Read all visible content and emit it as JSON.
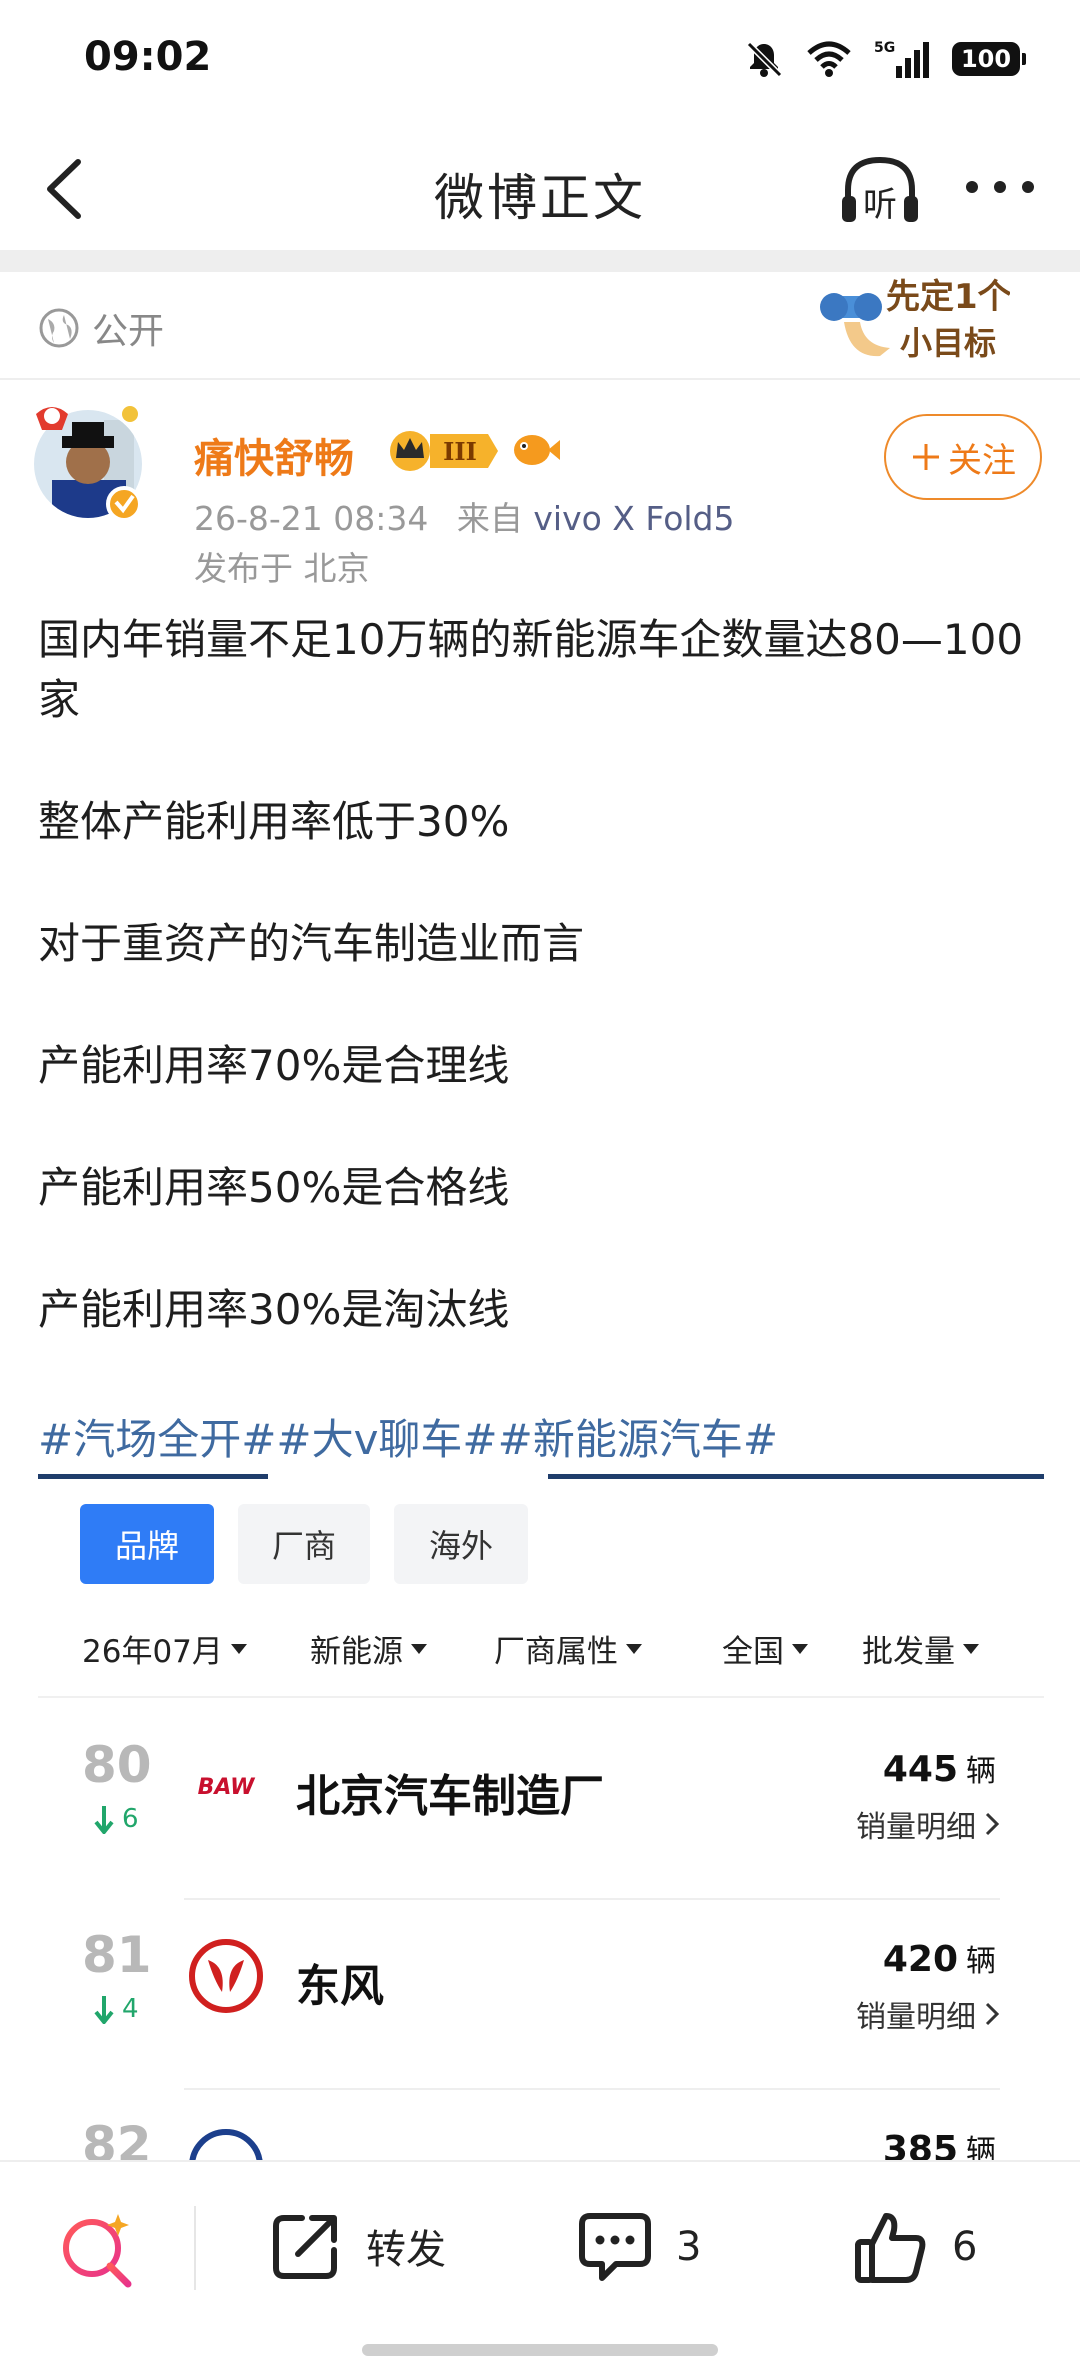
{
  "status_bar": {
    "time": "09:02",
    "network": "5G",
    "battery": "100"
  },
  "nav": {
    "title": "微博正文",
    "listen_label": "听"
  },
  "visibility": {
    "label": "公开"
  },
  "sticker_text": [
    "先定1个",
    "小目标"
  ],
  "author": {
    "name": "痛快舒畅",
    "level_badge": "III",
    "time": "26-8-21 08:34",
    "source_prefix": "来自",
    "device": "vivo X Fold5",
    "location": "发布于 北京",
    "follow_label": "关注"
  },
  "post": {
    "paragraphs": [
      "国内年销量不足10万辆的新能源车企数量达80—100家",
      "整体产能利用率低于30%",
      "对于重资产的汽车制造业而言",
      "产能利用率70%是合理线",
      "产能利用率50%是合格线",
      "产能利用率30%是淘汰线"
    ],
    "hashtags": "#汽场全开##大v聊车##新能源汽车#"
  },
  "card": {
    "tabs": [
      {
        "label": "品牌",
        "active": true
      },
      {
        "label": "厂商",
        "active": false
      },
      {
        "label": "海外",
        "active": false
      }
    ],
    "filters": [
      "26年07月",
      "新能源",
      "厂商属性",
      "全国",
      "批发量"
    ],
    "rows": [
      {
        "rank": "80",
        "delta": "6",
        "logo": "BAW",
        "name": "北京汽车制造厂",
        "qty": "445",
        "unit": "辆",
        "detail": "销量明细"
      },
      {
        "rank": "81",
        "delta": "4",
        "logo": "dongfeng-logo",
        "name": "东风",
        "qty": "420",
        "unit": "辆",
        "detail": "销量明细"
      },
      {
        "rank": "82",
        "delta": "",
        "logo": "circle-logo",
        "name": "",
        "qty": "385",
        "unit": "辆",
        "detail": ""
      }
    ]
  },
  "bottom_bar": {
    "repost_label": "转发",
    "comment_count": "3",
    "like_count": "6"
  },
  "colors": {
    "accent_orange": "#ee7a18",
    "link_blue": "#3f6aa0",
    "tab_blue": "#2f7cf6",
    "down_green": "#21a66b"
  }
}
